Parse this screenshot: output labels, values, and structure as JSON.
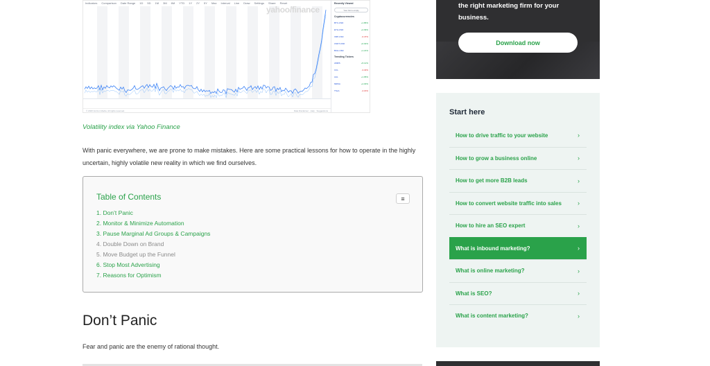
{
  "chart": {
    "watermark": "yahoo/finance",
    "toolbar": [
      "Indicators",
      "Comparison",
      "Date Range",
      "1D",
      "5D",
      "1M",
      "3M",
      "6M",
      "YTD",
      "1Y",
      "2Y",
      "5Y",
      "Max",
      "Interval",
      "Line",
      "Draw",
      "Settings",
      "Share",
      "Reset"
    ],
    "sidebar": {
      "recently_viewed": "Recently Viewed",
      "button": "Your list is empty",
      "crypto_head": "Cryptocurrencies",
      "crypto_rows": [
        {
          "symbol": "BTC-USD",
          "change": "+1.86%",
          "dir": "pos"
        },
        {
          "symbol": "ETH-USD",
          "change": "+2.09%",
          "dir": "pos"
        },
        {
          "symbol": "XRP-USD",
          "change": "-0.47%",
          "dir": "neg"
        },
        {
          "symbol": "USDT-USD",
          "change": "+0.02%",
          "dir": "pos"
        },
        {
          "symbol": "BCH-USD",
          "change": "+1.21%",
          "dir": "pos"
        }
      ],
      "trending_head": "Trending Tickers",
      "trending_rows": [
        {
          "symbol": "AMRS",
          "change": "+5.12%",
          "dir": "pos"
        },
        {
          "symbol": "CCL",
          "change": "-3.40%",
          "dir": "neg"
        },
        {
          "symbol": "AAL",
          "change": "+1.95%",
          "dir": "pos"
        },
        {
          "symbol": "MRNA",
          "change": "+4.30%",
          "dir": "pos"
        },
        {
          "symbol": "TSLA",
          "change": "-2.16%",
          "dir": "neg"
        }
      ]
    },
    "footer_left": "© 2020 Verizon Media. All rights reserved.",
    "footer_right": "Data Disclaimer · Help · Suggestions"
  },
  "article": {
    "caption": "Volatility index via Yahoo Finance",
    "intro": "With panic everywhere, we are prone to make mistakes. Here are some practical lessons for how to operate in the highly uncertain, highly volatile new reality in which we find ourselves.",
    "toc": {
      "title": "Table of Contents",
      "toggle_icon": "≡",
      "items": [
        {
          "label": "1. Don’t Panic",
          "dim": false
        },
        {
          "label": "2. Monitor & Minimize Automation",
          "dim": false
        },
        {
          "label": "3. Pause Marginal Ad Groups & Campaigns",
          "dim": false
        },
        {
          "label": "4. Double Down on Brand",
          "dim": true
        },
        {
          "label": "5. Move Budget up the Funnel",
          "dim": true
        },
        {
          "label": "6. Stop Most Advertising",
          "dim": false
        },
        {
          "label": "7. Reasons for Optimism",
          "dim": false
        }
      ]
    },
    "heading": "Don’t Panic",
    "paragraph": "Fear and panic are the enemy of rational thought."
  },
  "sidebar": {
    "promo_text": "the right marketing firm for your business.",
    "promo_button": "Download now",
    "start_title": "Start here",
    "links": [
      {
        "label": "How to drive traffic to your website",
        "active": false
      },
      {
        "label": "How to grow a business online",
        "active": false
      },
      {
        "label": "How to get more B2B leads",
        "active": false
      },
      {
        "label": "How to convert website traffic into sales",
        "active": false
      },
      {
        "label": "How to hire an SEO expert",
        "active": false
      },
      {
        "label": "What is inbound marketing?",
        "active": true
      },
      {
        "label": "What is online marketing?",
        "active": false
      },
      {
        "label": "What is SEO?",
        "active": false
      },
      {
        "label": "What is content marketing?",
        "active": false
      }
    ],
    "chevron": "›"
  },
  "colors": {
    "accent": "#2aa24a",
    "dark_panel": "#2f2f31",
    "sidebar_bg": "#eef4f2",
    "chart_line": "#3b82f6"
  }
}
